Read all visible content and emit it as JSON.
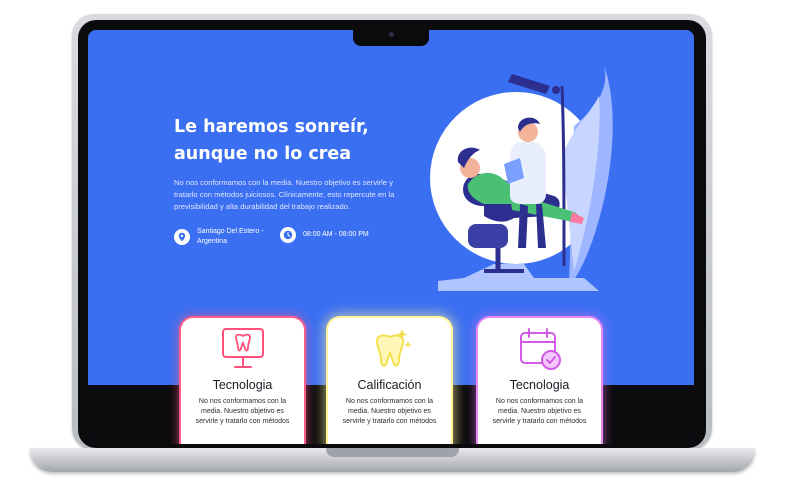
{
  "hero": {
    "title_line1": "Le haremos sonreír,",
    "title_line2": "aunque no lo crea",
    "description": "No nos conformamos con la media. Nuestro objetivo es servirle y tratarlo con métodos juiciosos. Clínicamente, esto repercute en la previsibilidad y alta durabilidad del trabajo realizado.",
    "location_line1": "Santiago Del Estero -",
    "location_line2": "Argentina",
    "hours": "08:00 AM - 08:00 PM",
    "location_icon": "map-pin-icon",
    "clock_icon": "clock-icon"
  },
  "cards": [
    {
      "title": "Tecnologia",
      "text": "No nos conformamos con la media. Nuestro objetivo es servirle y tratarlo con métodos",
      "icon": "monitor-tooth-icon",
      "color": "#ff4f7a"
    },
    {
      "title": "Calificación",
      "text": "No nos conformamos con la media. Nuestro objetivo es servirle y tratarlo con métodos",
      "icon": "sparkling-tooth-icon",
      "color": "#f2e04f"
    },
    {
      "title": "Tecnologia",
      "text": "No nos conformamos con la media. Nuestro objetivo es servirle y tratarlo con métodos",
      "icon": "calendar-check-icon",
      "color": "#d25ae8"
    }
  ],
  "colors": {
    "hero_background": "#3b6ff2",
    "card_background": "#ffffff",
    "illustration_circle": "#ffffff"
  }
}
